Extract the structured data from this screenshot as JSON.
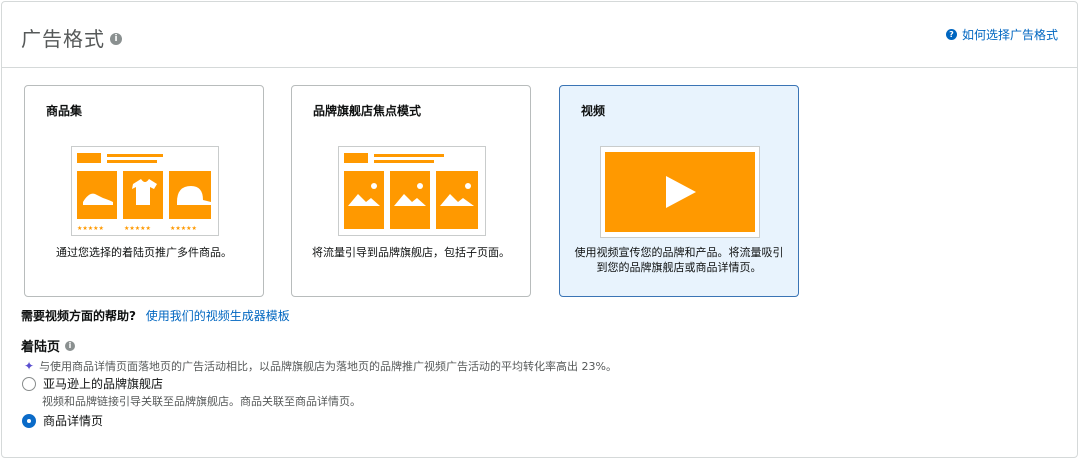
{
  "header": {
    "title": "广告格式",
    "help_link": "如何选择广告格式"
  },
  "cards": [
    {
      "title": "商品集",
      "desc": "通过您选择的着陆页推广多件商品。",
      "selected": false
    },
    {
      "title": "品牌旗舰店焦点模式",
      "desc": "将流量引导到品牌旗舰店，包括子页面。",
      "selected": false
    },
    {
      "title": "视频",
      "desc_line1": "使用视频宣传您的品牌和产品。将流量吸引",
      "desc_line2": "到您的品牌旗舰店或商品详情页。",
      "selected": true
    }
  ],
  "video_help": {
    "question": "需要视频方面的帮助?",
    "link": "使用我们的视频生成器模板"
  },
  "landing_page": {
    "title": "着陆页",
    "note": "与使用商品详情页面落地页的广告活动相比，以品牌旗舰店为落地页的品牌推广视频广告活动的平均转化率高出 23%。",
    "options": [
      {
        "label": "亚马逊上的品牌旗舰店",
        "sub": "视频和品牌链接引导关联至品牌旗舰店。商品关联至商品详情页。",
        "checked": false
      },
      {
        "label": "商品详情页",
        "checked": true
      }
    ]
  },
  "colors": {
    "accent_orange": "#ff9900",
    "link_blue": "#0066c0",
    "selected_bg": "#e8f3fd"
  }
}
